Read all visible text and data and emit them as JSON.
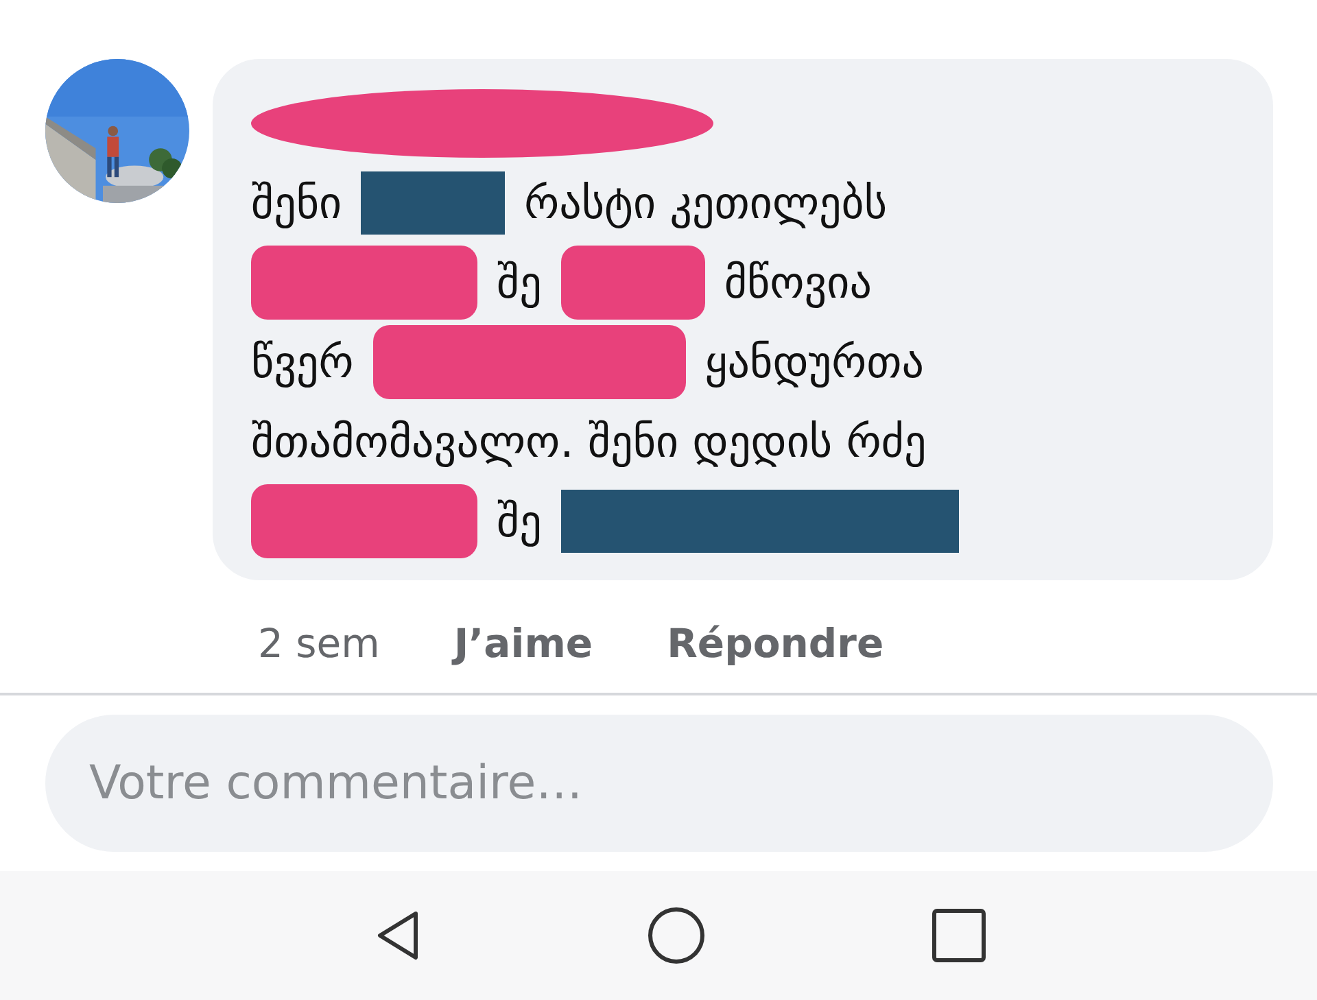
{
  "comment": {
    "avatar": {
      "kind": "picture"
    },
    "lines": [
      [
        {
          "kind": "oval-long",
          "color": "#e8417b"
        }
      ],
      [
        {
          "kind": "text",
          "text": "შენი"
        },
        {
          "kind": "block-short",
          "color": "#255371"
        },
        {
          "kind": "text",
          "text": "რასტი კეთილებს"
        }
      ],
      [
        {
          "kind": "pill-medium",
          "color": "#e8417b"
        },
        {
          "kind": "text",
          "text": "შე"
        },
        {
          "kind": "pill-short",
          "color": "#e8417b"
        },
        {
          "kind": "text",
          "text": "მწოვია"
        }
      ],
      [
        {
          "kind": "text",
          "text": "წვერ"
        },
        {
          "kind": "pill-wide",
          "color": "#e8417b"
        },
        {
          "kind": "text",
          "text": "ყანდურთა"
        }
      ],
      [
        {
          "kind": "text",
          "text": "შთამომავალო. შენი დედის რძე"
        }
      ],
      [
        {
          "kind": "pill-medium",
          "color": "#e8417b"
        },
        {
          "kind": "text",
          "text": "შე"
        },
        {
          "kind": "block-long",
          "color": "#255371"
        }
      ]
    ],
    "actions": [
      {
        "kind": "time",
        "text": "2 sem"
      },
      {
        "kind": "action",
        "text": "J’aime"
      },
      {
        "kind": "action",
        "text": "Répondre"
      }
    ]
  },
  "composer": {
    "placeholder": "Votre commentaire…"
  },
  "nav_bar": [
    {
      "kind": "back"
    },
    {
      "kind": "home"
    },
    {
      "kind": "recents"
    }
  ]
}
